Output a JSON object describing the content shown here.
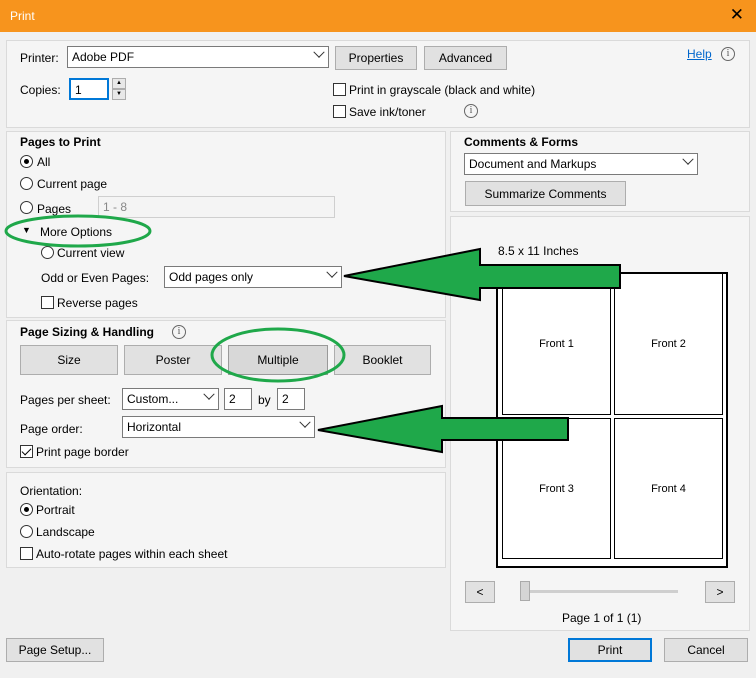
{
  "window": {
    "title": "Print",
    "close_glyph": "✕"
  },
  "printer": {
    "label": "Printer:",
    "value": "Adobe PDF",
    "properties_label": "Properties",
    "advanced_label": "Advanced",
    "help_label": "Help",
    "copies_label": "Copies:",
    "copies_value": "1",
    "grayscale_label": "Print in grayscale (black and white)",
    "grayscale_checked": false,
    "save_ink_label": "Save ink/toner",
    "save_ink_checked": false
  },
  "pages_to_print": {
    "heading": "Pages to Print",
    "all_label": "All",
    "current_page_label": "Current page",
    "pages_label": "Pages",
    "pages_value": "1 - 8",
    "more_options_label": "More Options",
    "current_view_label": "Current view",
    "odd_even_label": "Odd or Even Pages:",
    "odd_even_value": "Odd pages only",
    "reverse_label": "Reverse pages",
    "selected": "All"
  },
  "sizing": {
    "heading": "Page Sizing & Handling",
    "tabs": [
      "Size",
      "Poster",
      "Multiple",
      "Booklet"
    ],
    "active_tab": "Multiple",
    "pages_per_sheet_label": "Pages per sheet:",
    "pages_per_sheet_value": "Custom...",
    "cols": "2",
    "by_label": "by",
    "rows": "2",
    "page_order_label": "Page order:",
    "page_order_value": "Horizontal",
    "border_label": "Print page border",
    "border_checked": true
  },
  "orientation": {
    "heading": "Orientation:",
    "portrait_label": "Portrait",
    "landscape_label": "Landscape",
    "autorotate_label": "Auto-rotate pages within each sheet",
    "selected": "Portrait"
  },
  "comments": {
    "heading": "Comments & Forms",
    "value": "Document and Markups",
    "summarize_label": "Summarize Comments"
  },
  "preview": {
    "size_label": "8.5 x 11 Inches",
    "pages": [
      "Front 1",
      "Front 2",
      "Front 3",
      "Front 4"
    ],
    "prev_label": "<",
    "next_label": ">",
    "page_status": "Page 1 of 1 (1)"
  },
  "footer": {
    "page_setup_label": "Page Setup...",
    "print_label": "Print",
    "cancel_label": "Cancel"
  },
  "colors": {
    "title_bar": "#f7941d",
    "annotation_green": "#1fa84a",
    "focus_blue": "#0078d7"
  },
  "icons": [
    "close-icon",
    "info-icon",
    "chevron-down-icon",
    "triangle-down-icon",
    "spin-up-icon",
    "spin-down-icon"
  ]
}
